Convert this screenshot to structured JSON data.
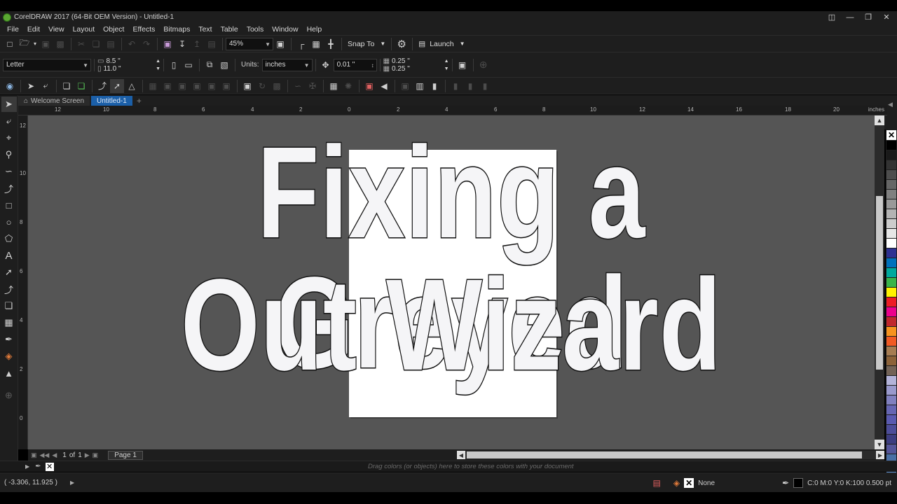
{
  "window": {
    "title": "CorelDRAW 2017 (64-Bit OEM Version) - Untitled-1"
  },
  "menu": [
    "File",
    "Edit",
    "View",
    "Layout",
    "Object",
    "Effects",
    "Bitmaps",
    "Text",
    "Table",
    "Tools",
    "Window",
    "Help"
  ],
  "toolbar1": {
    "zoom": "45%",
    "snap_to": "Snap To",
    "launch": "Launch"
  },
  "toolbar2": {
    "page_size": "Letter",
    "width": "8.5 \"",
    "height": "11.0 \"",
    "units_label": "Units:",
    "units_value": "inches",
    "nudge": "0.01 \"",
    "dup_x": "0.25 \"",
    "dup_y": "0.25 \""
  },
  "tabs": [
    {
      "label": "Welcome Screen",
      "active": false
    },
    {
      "label": "Untitled-1",
      "active": true
    }
  ],
  "ruler": {
    "unit": "inches",
    "h_labels": [
      "12",
      "10",
      "8",
      "6",
      "4",
      "2",
      "0",
      "2",
      "4",
      "6",
      "8",
      "10",
      "12",
      "14",
      "16",
      "18",
      "20"
    ],
    "v_labels": [
      "12",
      "10",
      "8",
      "6",
      "4",
      "2",
      "0"
    ]
  },
  "canvas": {
    "headline_line1": "Fixing a Greyed",
    "headline_line2": "Out Wizard"
  },
  "pagenav": {
    "current": "1",
    "of_label": "of",
    "total": "1",
    "page_tab": "Page 1"
  },
  "docpalette": {
    "hint": "Drag colors (or objects) here to store these colors with your document"
  },
  "status": {
    "coords": "( -3.306, 11.925 )",
    "fill": "None",
    "outline": "C:0 M:0 Y:0 K:100  0.500 pt"
  },
  "palette_colors": [
    "#000000",
    "#1a1a1a",
    "#333333",
    "#4d4d4d",
    "#666666",
    "#808080",
    "#999999",
    "#b3b3b3",
    "#cccccc",
    "#e6e6e6",
    "#ffffff",
    "#2e3192",
    "#0071bc",
    "#00a99d",
    "#39b54a",
    "#fff200",
    "#ed1c24",
    "#ec008c",
    "#c1272d",
    "#f7931e",
    "#f15a24",
    "#a67c52",
    "#8c6239",
    "#736357",
    "#b3b3d9",
    "#9999cc",
    "#8080bf",
    "#6666b3",
    "#5a5ab0",
    "#4d4d99",
    "#3d3d80",
    "#555599",
    "#4a6fa5",
    "#5b8fd0",
    "#7fb0e0",
    "#a8cdea"
  ]
}
